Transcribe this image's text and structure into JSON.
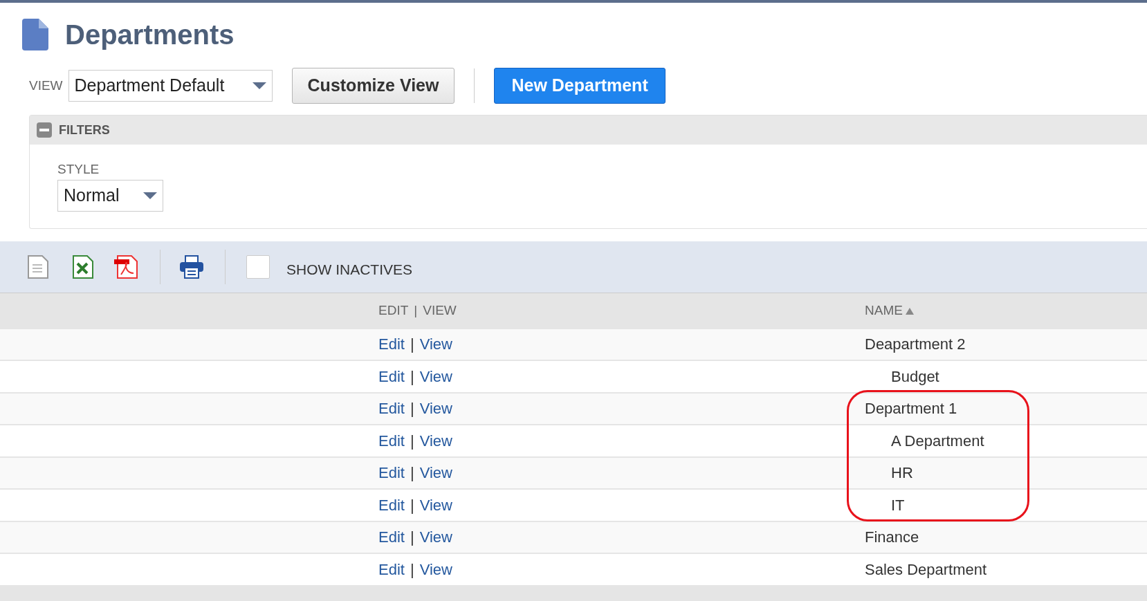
{
  "page": {
    "title": "Departments"
  },
  "view": {
    "label": "VIEW",
    "value": "Department Default"
  },
  "buttons": [
    {
      "label": "Customize View",
      "kind": "secondary"
    },
    {
      "label": "New Department",
      "kind": "primary"
    }
  ],
  "filters": {
    "title": "FILTERS",
    "expanded": true,
    "style": {
      "label": "STYLE",
      "value": "Normal"
    }
  },
  "toolbar": {
    "show_inactives": {
      "label": "SHOW INACTIVES",
      "checked": false
    }
  },
  "table": {
    "columns": [
      {
        "edit": "EDIT",
        "sep": "|",
        "view": "VIEW"
      },
      {
        "label": "NAME",
        "sort_ascending": true
      }
    ],
    "rows": [
      {
        "edit": "Edit",
        "sep": "|",
        "view": "View",
        "name": "Deapartment 2",
        "highlighted": false,
        "children": [
          {
            "edit": "Edit",
            "sep": "|",
            "view": "View",
            "name": "Budget"
          }
        ]
      },
      {
        "edit": "Edit",
        "sep": "|",
        "view": "View",
        "name": "Department 1",
        "highlighted": true,
        "children": [
          {
            "edit": "Edit",
            "sep": "|",
            "view": "View",
            "name": "A Department"
          },
          {
            "edit": "Edit",
            "sep": "|",
            "view": "View",
            "name": "HR"
          },
          {
            "edit": "Edit",
            "sep": "|",
            "view": "View",
            "name": "IT"
          }
        ]
      },
      {
        "edit": "Edit",
        "sep": "|",
        "view": "View",
        "name": "Finance",
        "highlighted": false
      },
      {
        "edit": "Edit",
        "sep": "|",
        "view": "View",
        "name": "Sales Department",
        "highlighted": false
      }
    ]
  }
}
